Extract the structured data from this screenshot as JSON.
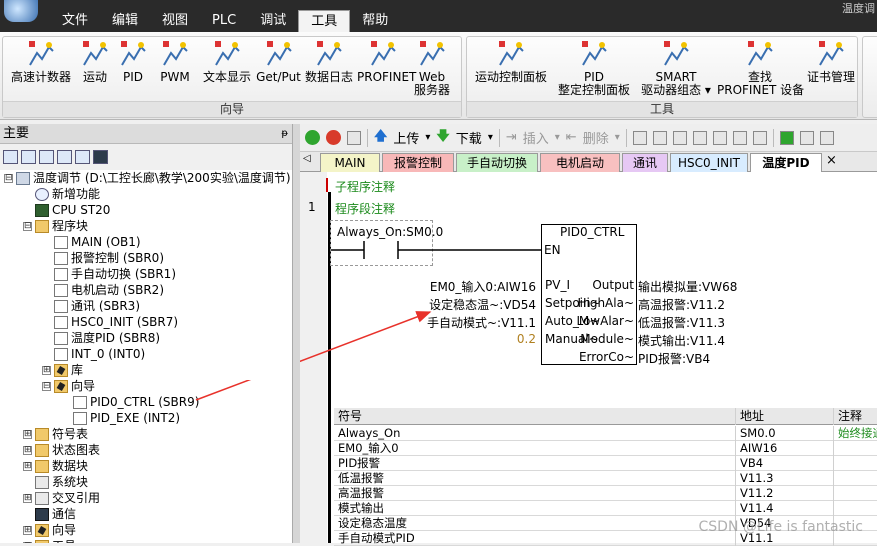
{
  "menubar": {
    "menus": [
      "文件",
      "编辑",
      "视图",
      "PLC",
      "调试",
      "工具",
      "帮助"
    ],
    "active": "工具",
    "topright": "温度调"
  },
  "ribbon": {
    "group1": {
      "label": "向导",
      "buttons": [
        "高速计数器",
        "运动",
        "PID",
        "PWM",
        "文本显示",
        "Get/Put",
        "数据日志",
        "PROFINET",
        "Web\n服务器"
      ]
    },
    "group2": {
      "label": "工具",
      "buttons": [
        "运动控制面板",
        "PID\n整定控制面板",
        "SMART\n驱动器组态 ▾",
        "查找\nPROFINET 设备",
        "证书管理"
      ]
    }
  },
  "left_pane": {
    "title": "主要",
    "pin": "ᵽ",
    "tree": [
      {
        "label": "温度调节 (D:\\工控长廊\\教学\\200实验\\温度调节)",
        "indent": 0,
        "expander": "⊟",
        "icon": "plc"
      },
      {
        "label": "新增功能",
        "indent": 1,
        "expander": "",
        "icon": "q"
      },
      {
        "label": "CPU ST20",
        "indent": 1,
        "expander": "",
        "icon": "cpu"
      },
      {
        "label": "程序块",
        "indent": 1,
        "expander": "⊟",
        "icon": "folder"
      },
      {
        "label": "MAIN (OB1)",
        "indent": 2,
        "expander": "",
        "icon": "doc"
      },
      {
        "label": "报警控制 (SBR0)",
        "indent": 2,
        "expander": "",
        "icon": "doc"
      },
      {
        "label": "手自动切换 (SBR1)",
        "indent": 2,
        "expander": "",
        "icon": "doc"
      },
      {
        "label": "电机启动 (SBR2)",
        "indent": 2,
        "expander": "",
        "icon": "doc"
      },
      {
        "label": "通讯 (SBR3)",
        "indent": 2,
        "expander": "",
        "icon": "doc"
      },
      {
        "label": "HSC0_INIT (SBR7)",
        "indent": 2,
        "expander": "",
        "icon": "doc"
      },
      {
        "label": "温度PID (SBR8)",
        "indent": 2,
        "expander": "",
        "icon": "doc"
      },
      {
        "label": "INT_0 (INT0)",
        "indent": 2,
        "expander": "",
        "icon": "doc"
      },
      {
        "label": "库",
        "indent": 2,
        "expander": "⊞",
        "icon": "wizard"
      },
      {
        "label": "向导",
        "indent": 2,
        "expander": "⊟",
        "icon": "wizard"
      },
      {
        "label": "PID0_CTRL (SBR9)",
        "indent": 3,
        "expander": "",
        "icon": "doc"
      },
      {
        "label": "PID_EXE (INT2)",
        "indent": 3,
        "expander": "",
        "icon": "doc"
      },
      {
        "label": "符号表",
        "indent": 1,
        "expander": "⊞",
        "icon": "folder"
      },
      {
        "label": "状态图表",
        "indent": 1,
        "expander": "⊞",
        "icon": "folder"
      },
      {
        "label": "数据块",
        "indent": 1,
        "expander": "⊞",
        "icon": "folder"
      },
      {
        "label": "系统块",
        "indent": 1,
        "expander": "",
        "icon": "chart"
      },
      {
        "label": "交叉引用",
        "indent": 1,
        "expander": "⊞",
        "icon": "chart"
      },
      {
        "label": "通信",
        "indent": 1,
        "expander": "",
        "icon": "mon"
      },
      {
        "label": "向导",
        "indent": 1,
        "expander": "⊞",
        "icon": "wizard"
      },
      {
        "label": "工具",
        "indent": 1,
        "expander": "⊞",
        "icon": "folder"
      }
    ]
  },
  "editor_toolbar": {
    "upload": "上传",
    "download": "下载",
    "insert": "插入",
    "delete": "删除"
  },
  "tabs": [
    {
      "label": "MAIN",
      "color": "#f4f4c8"
    },
    {
      "label": "报警控制",
      "color": "#f8b8b8"
    },
    {
      "label": "手自动切换",
      "color": "#c8f0c8"
    },
    {
      "label": "电机启动",
      "color": "#f8c0c0"
    },
    {
      "label": "通讯",
      "color": "#e6c8f4"
    },
    {
      "label": "HSC0_INIT",
      "color": "#d8ecff"
    },
    {
      "label": "温度PID",
      "color": "#ffffff"
    }
  ],
  "tab_close": "×",
  "editor": {
    "subroutine_comment": "子程序注释",
    "network_no": "1",
    "network_comment": "程序段注释",
    "contact": "Always_On:SM0.0",
    "block_name": "PID0_CTRL",
    "en": "EN",
    "inputs": [
      {
        "operand": "EM0_输入0:AIW16",
        "pin": "PV_I"
      },
      {
        "operand": "设定稳态温~:VD54",
        "pin": "Setpoin~"
      },
      {
        "operand": "手自动模式~:V11.1",
        "pin": "Auto_M~"
      },
      {
        "operand": "0.2",
        "pin": "Manual~"
      }
    ],
    "outputs": [
      {
        "pin": "Output",
        "operand": "输出模拟量:VW68"
      },
      {
        "pin": "HighAla~",
        "operand": "高温报警:V11.2"
      },
      {
        "pin": "LowAlar~",
        "operand": "低温报警:V11.3"
      },
      {
        "pin": "Module~",
        "operand": "模式输出:V11.4"
      },
      {
        "pin": "ErrorCo~",
        "operand": "PID报警:VB4"
      }
    ],
    "annotation_color": "#e8322b"
  },
  "symbol_table": {
    "headers": [
      "符号",
      "地址",
      "注释"
    ],
    "rows": [
      [
        "Always_On",
        "SM0.0",
        "始终接通"
      ],
      [
        "EM0_输入0",
        "AIW16",
        ""
      ],
      [
        "PID报警",
        "VB4",
        ""
      ],
      [
        "低温报警",
        "V11.3",
        ""
      ],
      [
        "高温报警",
        "V11.2",
        ""
      ],
      [
        "模式输出",
        "V11.4",
        ""
      ],
      [
        "设定稳态温度",
        "VD54",
        ""
      ],
      [
        "手自动模式PID",
        "V11.1",
        ""
      ]
    ]
  },
  "watermark": "CSDN @Life is fantastic"
}
